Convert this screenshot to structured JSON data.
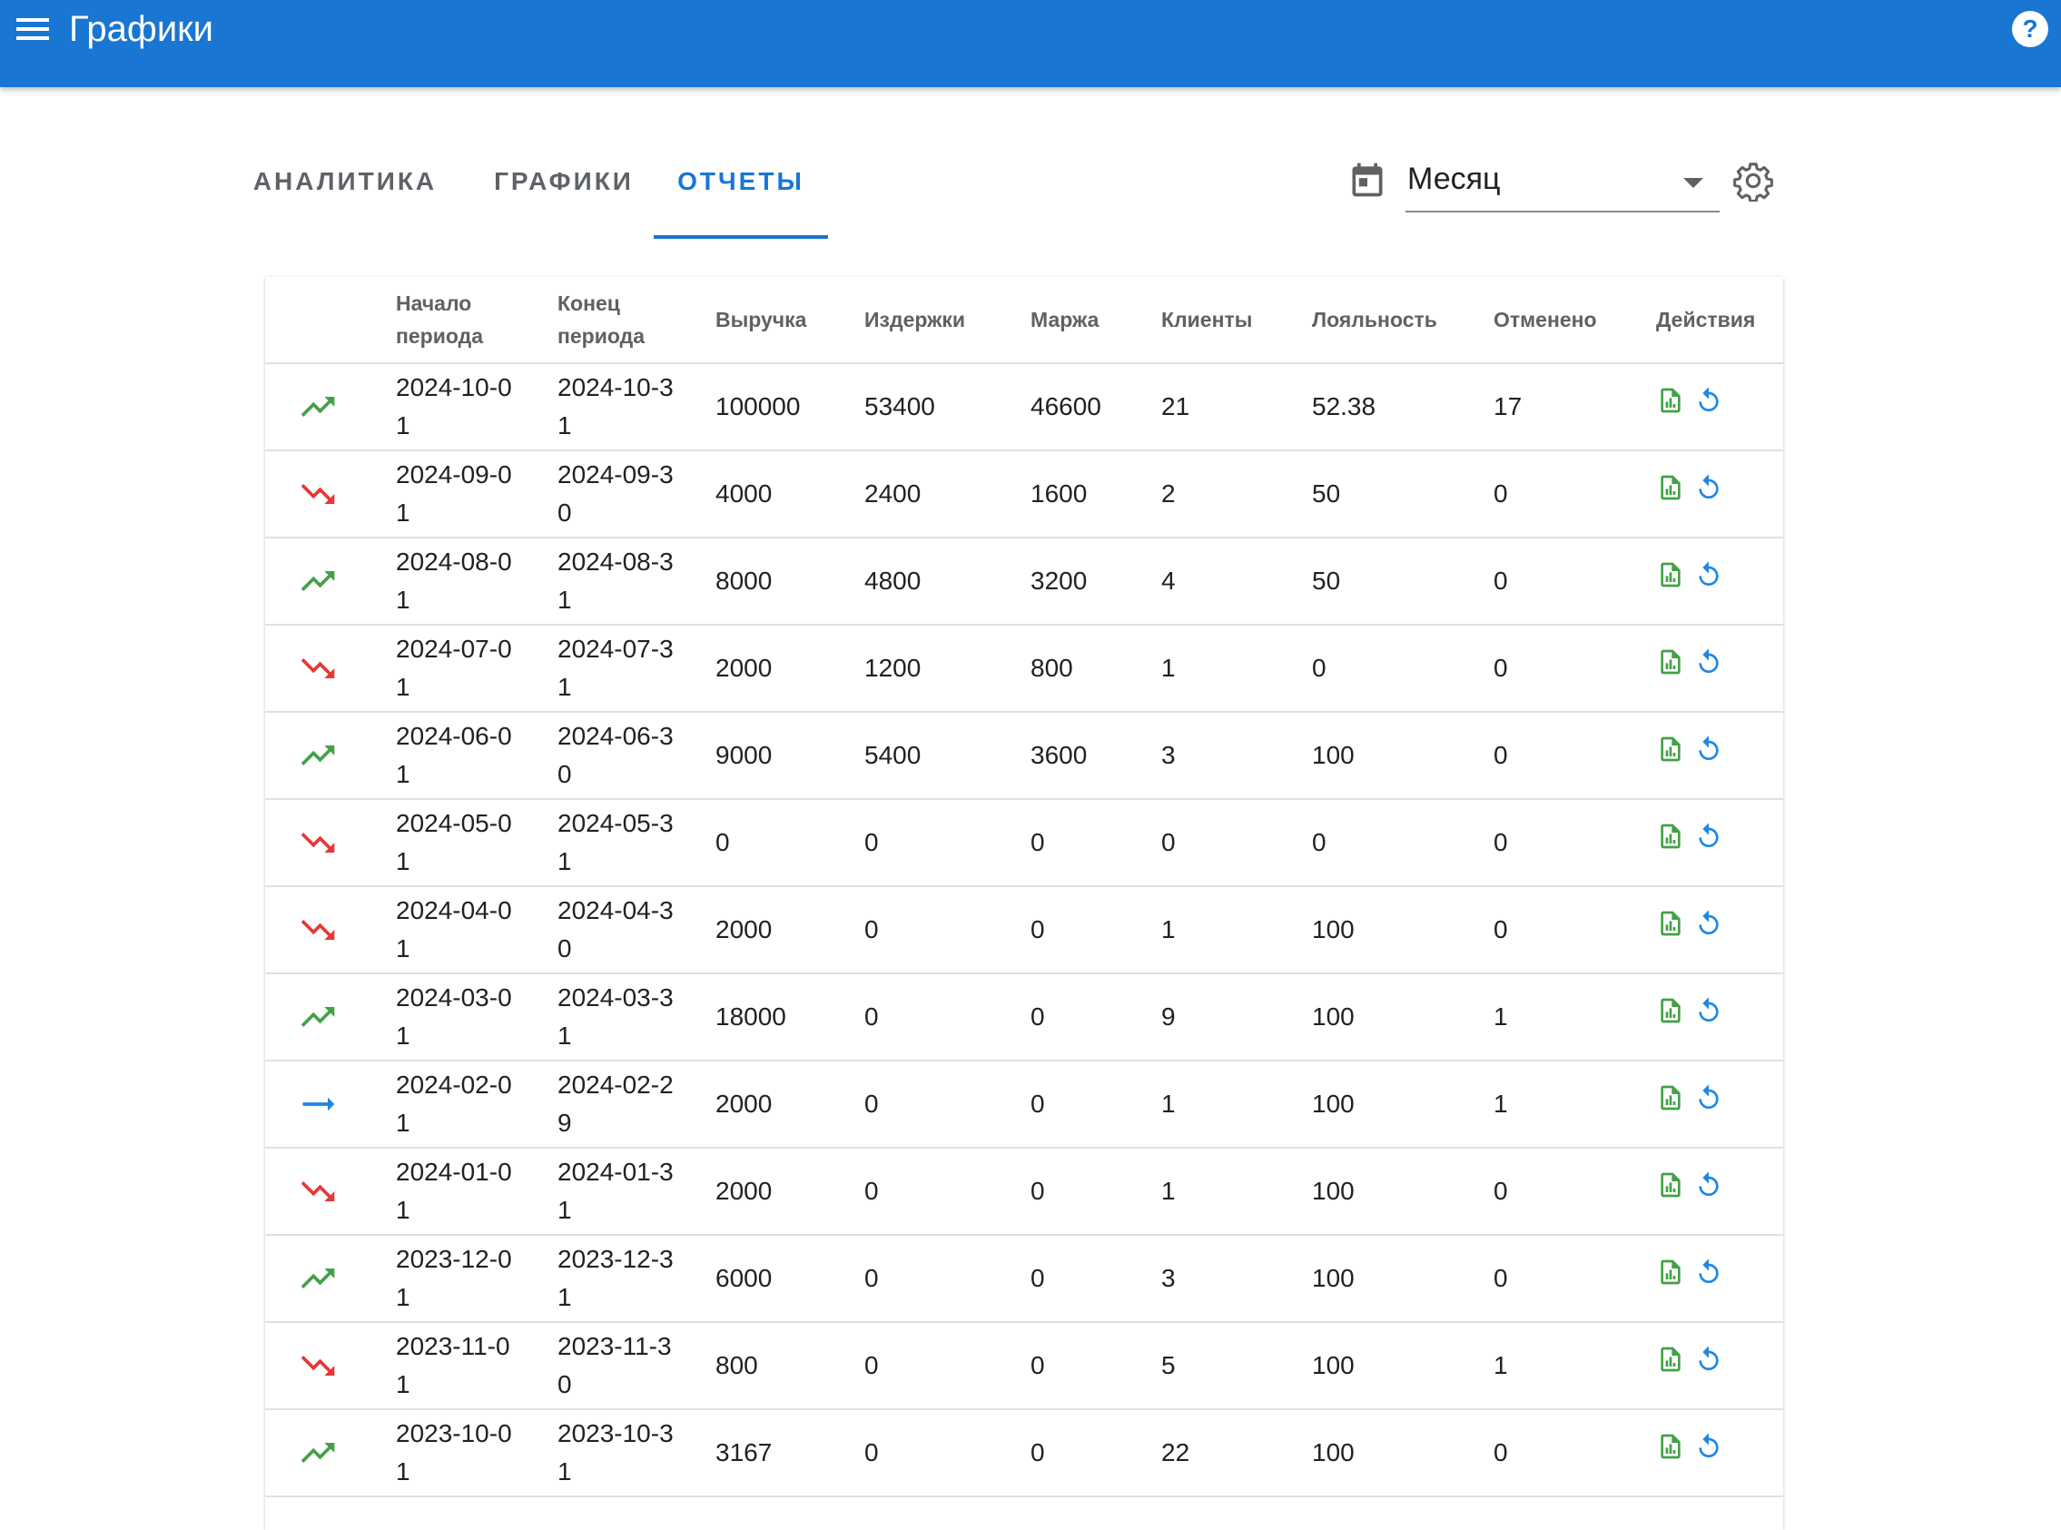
{
  "appbar": {
    "title": "Графики"
  },
  "tabs": [
    {
      "label": "АНАЛИТИКА",
      "active": false
    },
    {
      "label": "ГРАФИКИ",
      "active": false
    },
    {
      "label": "ОТЧЕТЫ",
      "active": true
    }
  ],
  "period_select": {
    "value": "Месяц"
  },
  "colors": {
    "primary": "#1976d2",
    "trend_up": "#43a047",
    "trend_down": "#e53935",
    "trend_flat": "#1e88e5",
    "report_icon": "#43a047",
    "refresh_icon": "#1e88e5"
  },
  "table": {
    "headers": {
      "start": "Начало периода",
      "end": "Конец периода",
      "revenue": "Выручка",
      "costs": "Издержки",
      "margin": "Маржа",
      "clients": "Клиенты",
      "loyalty": "Лояльность",
      "cancelled": "Отменено",
      "actions": "Действия"
    },
    "rows": [
      {
        "trend": "up",
        "start": "2024-10-01",
        "end": "2024-10-31",
        "revenue": "100000",
        "costs": "53400",
        "margin": "46600",
        "clients": "21",
        "loyalty": "52.38",
        "cancelled": "17"
      },
      {
        "trend": "down",
        "start": "2024-09-01",
        "end": "2024-09-30",
        "revenue": "4000",
        "costs": "2400",
        "margin": "1600",
        "clients": "2",
        "loyalty": "50",
        "cancelled": "0"
      },
      {
        "trend": "up",
        "start": "2024-08-01",
        "end": "2024-08-31",
        "revenue": "8000",
        "costs": "4800",
        "margin": "3200",
        "clients": "4",
        "loyalty": "50",
        "cancelled": "0"
      },
      {
        "trend": "down",
        "start": "2024-07-01",
        "end": "2024-07-31",
        "revenue": "2000",
        "costs": "1200",
        "margin": "800",
        "clients": "1",
        "loyalty": "0",
        "cancelled": "0"
      },
      {
        "trend": "up",
        "start": "2024-06-01",
        "end": "2024-06-30",
        "revenue": "9000",
        "costs": "5400",
        "margin": "3600",
        "clients": "3",
        "loyalty": "100",
        "cancelled": "0"
      },
      {
        "trend": "down",
        "start": "2024-05-01",
        "end": "2024-05-31",
        "revenue": "0",
        "costs": "0",
        "margin": "0",
        "clients": "0",
        "loyalty": "0",
        "cancelled": "0"
      },
      {
        "trend": "down",
        "start": "2024-04-01",
        "end": "2024-04-30",
        "revenue": "2000",
        "costs": "0",
        "margin": "0",
        "clients": "1",
        "loyalty": "100",
        "cancelled": "0"
      },
      {
        "trend": "up",
        "start": "2024-03-01",
        "end": "2024-03-31",
        "revenue": "18000",
        "costs": "0",
        "margin": "0",
        "clients": "9",
        "loyalty": "100",
        "cancelled": "1"
      },
      {
        "trend": "flat",
        "start": "2024-02-01",
        "end": "2024-02-29",
        "revenue": "2000",
        "costs": "0",
        "margin": "0",
        "clients": "1",
        "loyalty": "100",
        "cancelled": "1"
      },
      {
        "trend": "down",
        "start": "2024-01-01",
        "end": "2024-01-31",
        "revenue": "2000",
        "costs": "0",
        "margin": "0",
        "clients": "1",
        "loyalty": "100",
        "cancelled": "0"
      },
      {
        "trend": "up",
        "start": "2023-12-01",
        "end": "2023-12-31",
        "revenue": "6000",
        "costs": "0",
        "margin": "0",
        "clients": "3",
        "loyalty": "100",
        "cancelled": "0"
      },
      {
        "trend": "down",
        "start": "2023-11-01",
        "end": "2023-11-30",
        "revenue": "800",
        "costs": "0",
        "margin": "0",
        "clients": "5",
        "loyalty": "100",
        "cancelled": "1"
      },
      {
        "trend": "up",
        "start": "2023-10-01",
        "end": "2023-10-31",
        "revenue": "3167",
        "costs": "0",
        "margin": "0",
        "clients": "22",
        "loyalty": "100",
        "cancelled": "0"
      }
    ]
  }
}
